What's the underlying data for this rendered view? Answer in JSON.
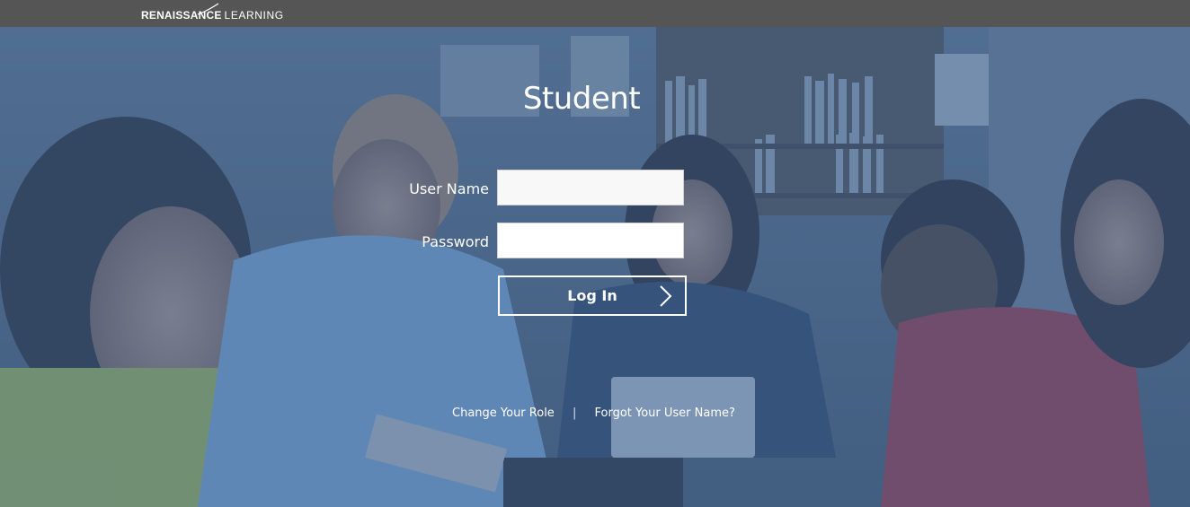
{
  "header": {
    "logo_strong": "RENAISSANCE",
    "logo_light": "LEARNING"
  },
  "login": {
    "title": "Student",
    "username_label": "User Name",
    "username_value": "",
    "password_label": "Password",
    "password_value": "",
    "submit_label": "Log In"
  },
  "footer": {
    "change_role": "Change Your Role",
    "separator": "|",
    "forgot_username": "Forgot Your User Name?"
  },
  "colors": {
    "topbar": "#555555",
    "overlay": "#3c5f8c",
    "text": "#ffffff"
  },
  "icons": {
    "submit": "chevron-right-icon",
    "logo_mark": "swoosh-icon"
  }
}
